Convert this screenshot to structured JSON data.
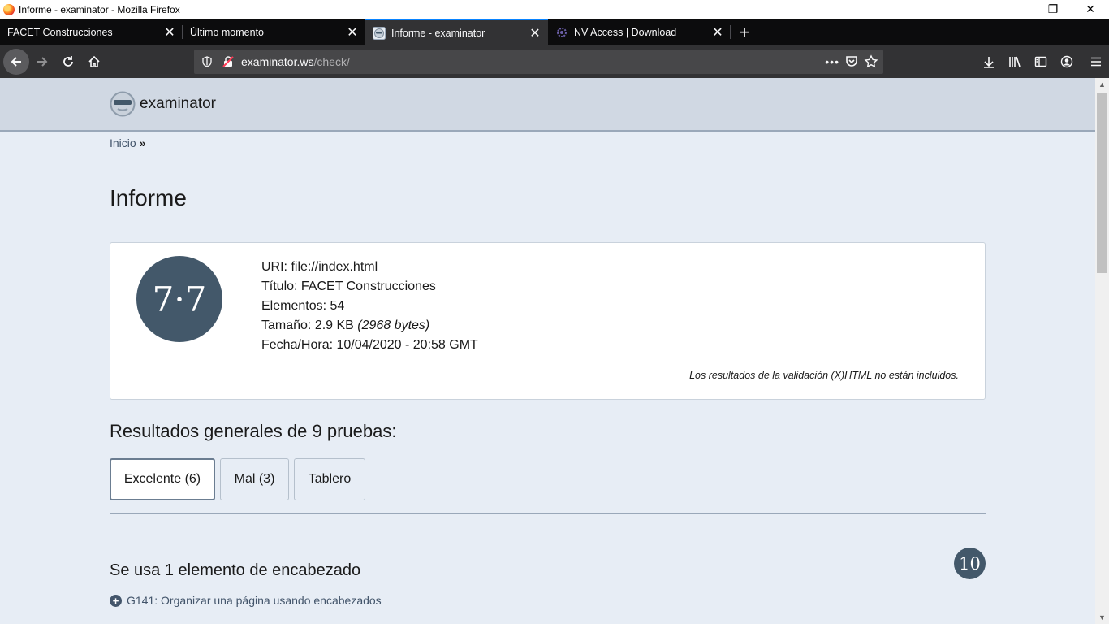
{
  "window": {
    "title": "Informe - examinator - Mozilla Firefox",
    "controls": [
      "—",
      "❐",
      "✕"
    ]
  },
  "tabs": [
    {
      "label": "FACET Construcciones",
      "active": false
    },
    {
      "label": "Último momento",
      "active": false
    },
    {
      "label": "Informe - examinator",
      "active": true
    },
    {
      "label": "NV Access | Download",
      "active": false
    }
  ],
  "navbar": {
    "url_host": "examinator.ws",
    "url_path": "/check/",
    "page_actions_icon": "•••"
  },
  "site": {
    "name": "examinator",
    "logo_icon": "sunglasses-face-icon"
  },
  "breadcrumb": {
    "home": "Inicio",
    "separator": "»"
  },
  "page": {
    "title": "Informe"
  },
  "summary": {
    "score": "7·7",
    "uri": "URI: file://index.html",
    "titulo": "Título: FACET Construcciones",
    "elementos": "Elementos: 54",
    "tamano": "Tamaño: 2.9 KB",
    "tamano_bytes": "(2968 bytes)",
    "fecha": "Fecha/Hora: 10/04/2020 - 20:58 GMT",
    "note": "Los resultados de la validación (X)HTML no están incluidos."
  },
  "results": {
    "title": "Resultados generales de 9 pruebas:",
    "filters": [
      {
        "label": "Excelente (6)",
        "active": true
      },
      {
        "label": "Mal (3)",
        "active": false
      },
      {
        "label": "Tablero",
        "active": false
      }
    ]
  },
  "test": {
    "title": "Se usa 1 elemento de encabezado",
    "score": "10",
    "item": "G141: Organizar una página usando encabezados"
  },
  "colors": {
    "accent": "#0a84ff",
    "score_bg": "#43586a",
    "page_bg": "#e7edf5"
  }
}
